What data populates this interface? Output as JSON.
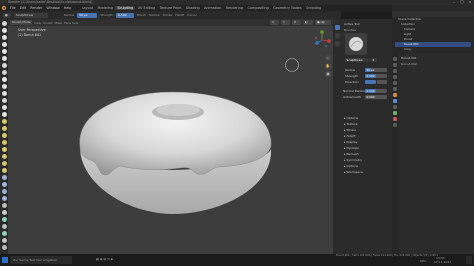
{
  "window": {
    "title": "Blender [C:\\Users\\seiler\\Desktop\\Sculpt\\donut.blend]"
  },
  "menubar": {
    "menus": [
      "File",
      "Edit",
      "Render",
      "Window",
      "Help"
    ],
    "workspaces": [
      "Layout",
      "Modeling",
      "Sculpting",
      "UV Editing",
      "Texture Paint",
      "Shading",
      "Animation",
      "Rendering",
      "Compositing",
      "Geometry Nodes",
      "Scripting"
    ],
    "scene": "Scene",
    "view_layer": "View Layer"
  },
  "tool_header": {
    "brush_name": "SculptDraw",
    "radius_label": "Radius",
    "radius_value": "50 px",
    "strength_label": "Strength",
    "strength_value": "0.500",
    "brush_menu": "Brush",
    "texture_menu": "Texture",
    "stroke_menu": "Stroke",
    "falloff_menu": "Falloff",
    "cursor_menu": "Cursor"
  },
  "viewport": {
    "mode": "Sculpt Mode",
    "menus": [
      "View",
      "Sculpt",
      "Mask",
      "Face Sets"
    ],
    "overlay_line1": "User Perspective",
    "overlay_line2": "(1) Donut.001"
  },
  "properties": {
    "tabs": [
      "Tool",
      "View",
      "Edit"
    ],
    "active_tool": "Active Tool",
    "brushes_header": "Brushes",
    "brush_field": "SculptDraw",
    "brush_users": "2",
    "settings": [
      {
        "label": "Radius",
        "value": "50 px",
        "fraction": 0.25
      },
      {
        "label": "Strength",
        "value": "0.500",
        "fraction": 0.5
      },
      {
        "label": "Direction",
        "value": ""
      },
      {
        "label": "Normal Radius",
        "value": "0.500",
        "fraction": 0.5
      },
      {
        "label": "Autosmooth",
        "value": "0.000",
        "fraction": 0.0
      }
    ],
    "panels": [
      "Options",
      "Texture",
      "Stroke",
      "Falloff",
      "Display",
      "Dyntopo",
      "Remesh",
      "Symmetry",
      "Options",
      "Workspace"
    ]
  },
  "outliner": {
    "header": "Scene Collection",
    "items": [
      {
        "label": "Collection",
        "selected": false
      },
      {
        "label": "Camera",
        "selected": false
      },
      {
        "label": "Light",
        "selected": false
      },
      {
        "label": "Donut",
        "selected": false
      },
      {
        "label": "Donut.001",
        "selected": true
      },
      {
        "label": "Icing",
        "selected": false
      }
    ]
  },
  "scene_props": {
    "object": "Donut.001",
    "mesh": "Donut.002"
  },
  "statusbar": {
    "left_hint": "Zur Suche Text hier eingeben",
    "stats": "Donut.001 | Verts 121,600 | Faces 121,600 | Tris 243,200 | Objects 1/3 | 2.93.1",
    "time": "10:54",
    "date": "17.11.2021",
    "language": "DEU"
  },
  "colors": {
    "accent": "#4772b3",
    "viewport_bg": "#3d3d3d",
    "panel_bg": "#2b2b2b",
    "selected_row": "#334d80"
  },
  "icons": [
    "blender-logo-icon",
    "brush-icon",
    "gizmo-icon",
    "camera-icon",
    "hand-icon",
    "zoom-icon"
  ]
}
